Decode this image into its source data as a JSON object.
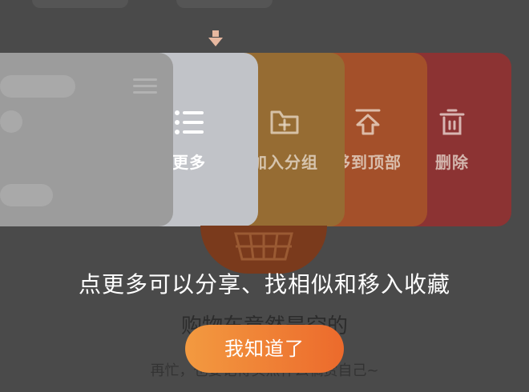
{
  "card_actions": {
    "more_label": "更多",
    "add_group_label": "加入分组",
    "move_top_label": "移到顶部",
    "delete_label": "删除"
  },
  "guide": {
    "text": "点更多可以分享、找相似和移入收藏",
    "confirm_label": "我知道了"
  },
  "empty_state": {
    "title": "购物车竟然是空的",
    "subtitle": "再忙，也要记得买点什么犒赏自己~"
  },
  "icons": {
    "more": "list-icon",
    "add_group": "folder-plus-icon",
    "move_top": "arrow-to-top-icon",
    "delete": "trash-icon",
    "arrow": "arrow-down-icon"
  },
  "colors": {
    "accent_start": "#f39a40",
    "accent_end": "#ec6a2c",
    "delete": "#8c3333",
    "move_top": "#a4502a",
    "add_group": "#966c33",
    "more": "#c1c3c8"
  }
}
